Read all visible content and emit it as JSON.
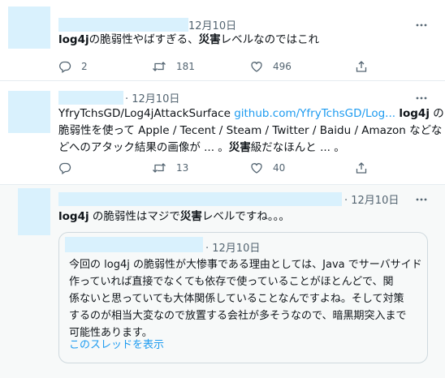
{
  "tweets": [
    {
      "time": "12月10日",
      "text": {
        "bold1": "log4j",
        "rest1": "の脆弱性やばすぎる、",
        "bold2": "災害",
        "rest2": "レベルなのではこれ"
      },
      "actions": {
        "reply": "2",
        "retweet": "181",
        "like": "496"
      }
    },
    {
      "time": "· 12月10日",
      "line1": {
        "a": "YfryTchsGD/Log4jAttackSurface ",
        "link": "github.com/YfryTchsGD/Log...",
        "b": " ",
        "bold": "log4j",
        "c": " の"
      },
      "line2": "脆弱性を使って Apple / Tecent / Steam / Twitter / Baidu / Amazon などな",
      "line3": {
        "a": "どへのアタック結果の画像が ... 。",
        "bold": "災害",
        "b": "級だなほんと ... 。"
      },
      "actions": {
        "retweet": "13",
        "like": "40"
      }
    },
    {
      "time": "· 12月10日",
      "text": {
        "bold1": "log4j",
        "rest1": " の脆弱性はマジで",
        "bold2": "災害",
        "rest2": "レベルですね。。。"
      },
      "quote": {
        "time": "· 12月10日",
        "lines": [
          "今回の log4j の脆弱性が大惨事である理由としては、Java でサーバサイド",
          "作っていれば直接でなくても依存で使っていることがほとんどで、関",
          "係ないと思っていても大体関係していることなんですよね。そして対策",
          "するのが相当大変なので放置する会社が多そうなので、暗黒期突入まで",
          "可能性あります。"
        ],
        "show_thread": "このスレッドを表示"
      }
    }
  ],
  "icons": [
    "reply-icon",
    "retweet-icon",
    "like-icon",
    "share-icon",
    "more-icon"
  ],
  "colors": {
    "accent": "#1d9bf0",
    "placeholder": "#d9f1fd",
    "muted": "#536471"
  }
}
